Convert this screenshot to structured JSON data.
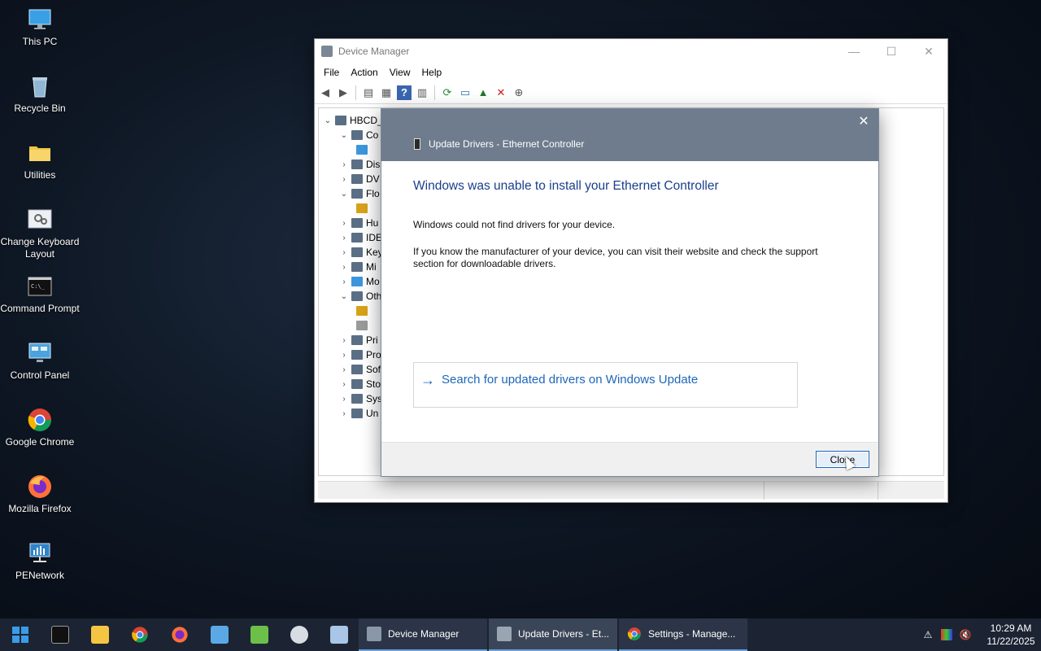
{
  "desktop": {
    "icons": [
      {
        "label": "This PC",
        "icon": "monitor-icon"
      },
      {
        "label": "Recycle Bin",
        "icon": "recycle-bin-icon"
      },
      {
        "label": "Utilities",
        "icon": "folder-icon"
      },
      {
        "label": "Change Keyboard Layout",
        "icon": "keyboard-settings-icon"
      },
      {
        "label": "Command Prompt",
        "icon": "terminal-icon"
      },
      {
        "label": "Control Panel",
        "icon": "control-panel-icon"
      },
      {
        "label": "Google Chrome",
        "icon": "chrome-icon"
      },
      {
        "label": "Mozilla Firefox",
        "icon": "firefox-icon"
      },
      {
        "label": "PENetwork",
        "icon": "network-icon"
      }
    ]
  },
  "device_manager": {
    "title": "Device Manager",
    "menu": [
      "File",
      "Action",
      "View",
      "Help"
    ],
    "tree": [
      {
        "label": "HBCD_",
        "expanded": true
      },
      {
        "label": "Co",
        "expanded": true
      },
      {
        "label": "",
        "leaf": true
      },
      {
        "label": "Dis",
        "expanded": false
      },
      {
        "label": "DV",
        "expanded": false
      },
      {
        "label": "Flo",
        "expanded": true
      },
      {
        "label": "",
        "leaf": true
      },
      {
        "label": "Hu",
        "expanded": false
      },
      {
        "label": "IDE",
        "expanded": false
      },
      {
        "label": "Key",
        "expanded": false
      },
      {
        "label": "Mi",
        "expanded": false
      },
      {
        "label": "Mo",
        "expanded": false
      },
      {
        "label": "Oth",
        "expanded": true
      },
      {
        "label": "",
        "leaf": true
      },
      {
        "label": "",
        "leaf": true
      },
      {
        "label": "Pri",
        "expanded": false
      },
      {
        "label": "Pro",
        "expanded": false
      },
      {
        "label": "Sof",
        "expanded": false
      },
      {
        "label": "Sto",
        "expanded": false
      },
      {
        "label": "Sys",
        "expanded": false
      },
      {
        "label": "Un",
        "expanded": false
      }
    ]
  },
  "dialog": {
    "title": "Update Drivers - Ethernet Controller",
    "heading": "Windows was unable to install your Ethernet Controller",
    "paragraph1": "Windows could not find drivers for your device.",
    "paragraph2": "If you know the manufacturer of your device, you can visit their website and check the support section for downloadable drivers.",
    "search_option": "Search for updated drivers on Windows Update",
    "close_label": "Close"
  },
  "taskbar": {
    "tasks": [
      {
        "label": "Device Manager"
      },
      {
        "label": "Update Drivers - Et..."
      },
      {
        "label": "Settings - Manage..."
      }
    ],
    "time": "10:29 AM",
    "date": "11/22/2025"
  }
}
